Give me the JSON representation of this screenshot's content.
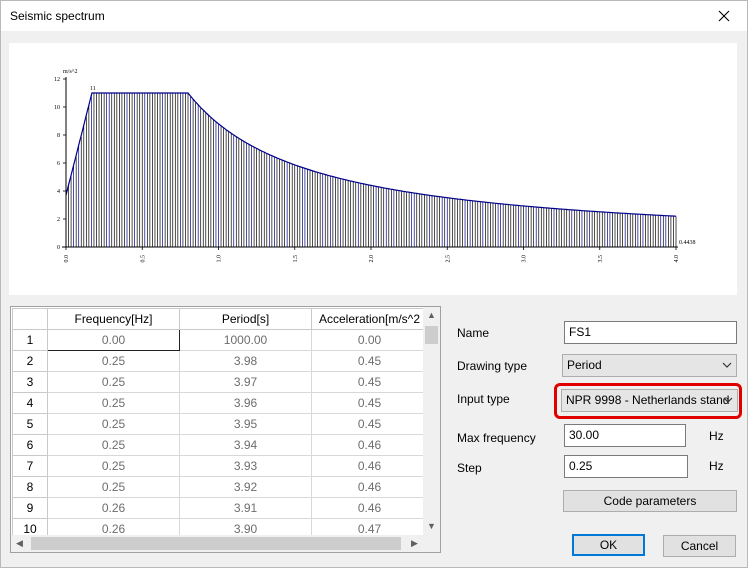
{
  "window": {
    "title": "Seismic spectrum"
  },
  "chart_data": {
    "type": "bar",
    "ylabel": "m/s^2",
    "xlim": [
      0,
      4
    ],
    "ylim": [
      0,
      12
    ],
    "xticks": [
      "0.0",
      "0.5",
      "1.0",
      "1.5",
      "2.0",
      "2.5",
      "3.0",
      "3.5",
      "4.0"
    ],
    "yticks": [
      "0",
      "2",
      "4",
      "6",
      "8",
      "10",
      "12"
    ],
    "annotations": {
      "peak_label": "11",
      "end_label": "0.4438"
    },
    "plateau": {
      "value": 11,
      "t_start": 0.17,
      "t_end": 0.8
    },
    "end_value": 0.4438,
    "bar_color": "#000000",
    "accent_color": "#00008b"
  },
  "table": {
    "columns": [
      "Frequency[Hz]",
      "Period[s]",
      "Acceleration[m/s^2"
    ],
    "rows": [
      {
        "index": "1",
        "freq": "0.00",
        "period": "1000.00",
        "accel": "0.00"
      },
      {
        "index": "2",
        "freq": "0.25",
        "period": "3.98",
        "accel": "0.45"
      },
      {
        "index": "3",
        "freq": "0.25",
        "period": "3.97",
        "accel": "0.45"
      },
      {
        "index": "4",
        "freq": "0.25",
        "period": "3.96",
        "accel": "0.45"
      },
      {
        "index": "5",
        "freq": "0.25",
        "period": "3.95",
        "accel": "0.45"
      },
      {
        "index": "6",
        "freq": "0.25",
        "period": "3.94",
        "accel": "0.46"
      },
      {
        "index": "7",
        "freq": "0.25",
        "period": "3.93",
        "accel": "0.46"
      },
      {
        "index": "8",
        "freq": "0.25",
        "period": "3.92",
        "accel": "0.46"
      },
      {
        "index": "9",
        "freq": "0.26",
        "period": "3.91",
        "accel": "0.46"
      },
      {
        "index": "10",
        "freq": "0.26",
        "period": "3.90",
        "accel": "0.47"
      }
    ]
  },
  "form": {
    "name_label": "Name",
    "name_value": "FS1",
    "drawing_type_label": "Drawing type",
    "drawing_type_value": "Period",
    "input_type_label": "Input type",
    "input_type_value": "NPR 9998 - Netherlands stand",
    "max_freq_label": "Max frequency",
    "max_freq_value": "30.00",
    "max_freq_unit": "Hz",
    "step_label": "Step",
    "step_value": "0.25",
    "step_unit": "Hz",
    "highlight_color": "#e00000"
  },
  "buttons": {
    "code_params": "Code parameters",
    "ok": "OK",
    "cancel": "Cancel"
  }
}
